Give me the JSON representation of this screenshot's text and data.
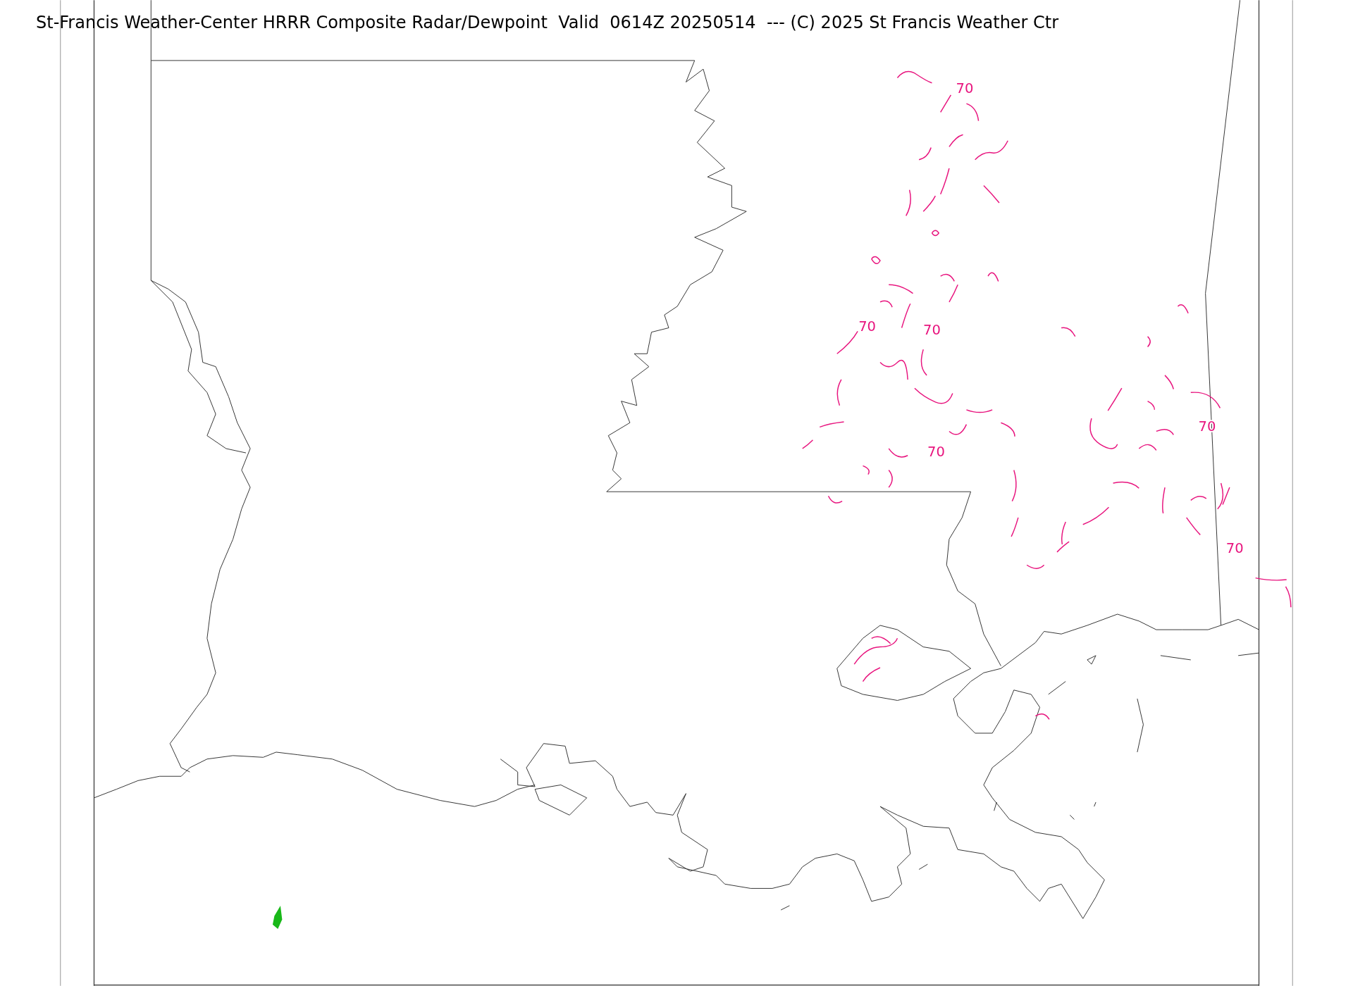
{
  "title": "St-Francis Weather-Center HRRR Composite Radar/Dewpoint  Valid  0614Z 20250514  --- (C) 2025 St Francis Weather Ctr",
  "contour_labels": [
    {
      "text": "70"
    },
    {
      "text": "70"
    },
    {
      "text": "70"
    },
    {
      "text": "70"
    },
    {
      "text": "70"
    },
    {
      "text": "70"
    }
  ]
}
